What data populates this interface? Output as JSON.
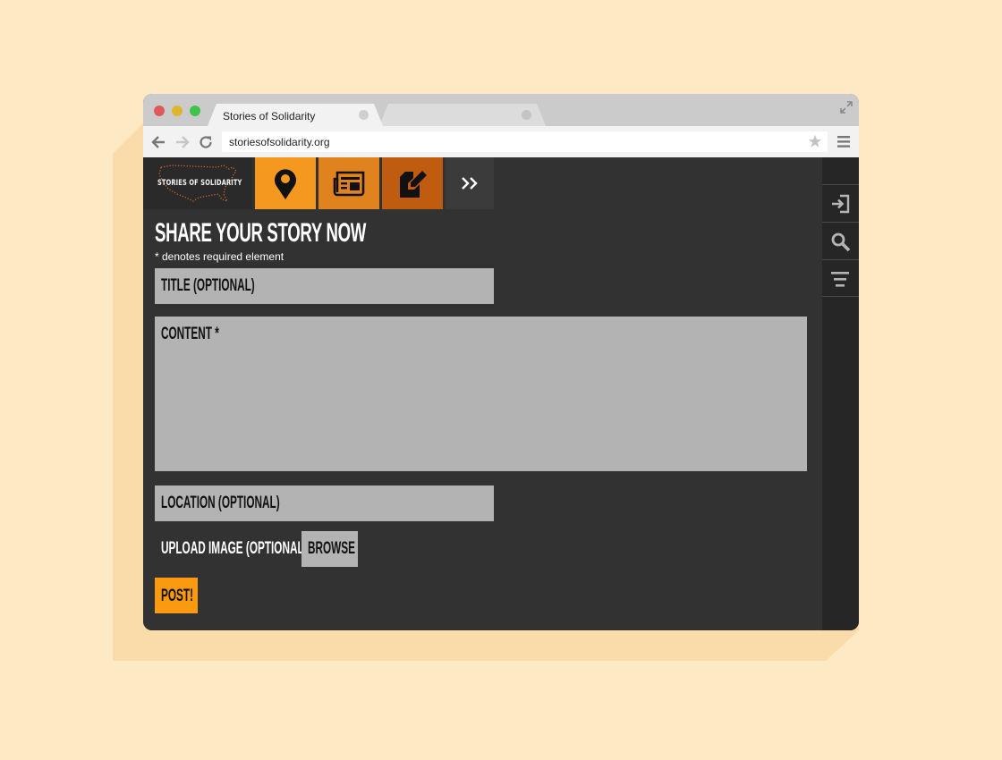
{
  "browser": {
    "active_tab_title": "Stories of Solidarity",
    "url": "storiesofsolidarity.org"
  },
  "site": {
    "logo_text": "STORIES OF SOLIDARITY",
    "nav": {
      "more_label": "»"
    }
  },
  "form": {
    "heading": "SHARE YOUR STORY NOW",
    "required_note": "* denotes required element",
    "title_placeholder": "TITLE (OPTIONAL)",
    "content_placeholder": "CONTENT *",
    "location_placeholder": "LOCATION (OPTIONAL)",
    "upload_label": "UPLOAD IMAGE (OPTIONAL)",
    "browse_label": "BROWSE",
    "post_label": "POST!"
  },
  "colors": {
    "page_bg": "#fde9c4",
    "nav_map": "#f5981f",
    "nav_news": "#e0831f",
    "nav_write": "#c05c0f",
    "post_button": "#f99a10"
  }
}
